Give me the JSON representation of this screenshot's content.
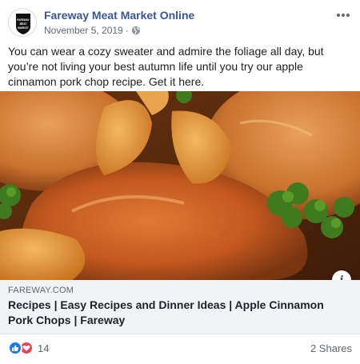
{
  "post": {
    "page_name": "Fareway Meat Market Online",
    "avatar_text": [
      "FAREWAY",
      "MEAT",
      "MARKET"
    ],
    "date": "November 5, 2019",
    "separator": "·",
    "privacy_icon": "globe-icon",
    "more_icon": "ellipsis-icon",
    "text": "You can wear a cozy sweater and admire the foliage all day, but you’re not living your best autumn life until you try our apple cinnamon pork chop recipe. Get it here."
  },
  "link": {
    "domain": "FAREWAY.COM",
    "title": "Recipes | Easy Recipes and Dinner Ideas | Apple Cinnamon Pork Chops | Fareway",
    "info_icon": "info-icon",
    "image_description_icon": "pork-chop-photo"
  },
  "footer": {
    "reaction_icons": [
      "like-icon",
      "love-icon"
    ],
    "reaction_count": "14",
    "shares": "2 Shares"
  },
  "colors": {
    "page_name": "#385898",
    "like": "#1877f2",
    "love": "#f33e58",
    "link_bg": "#f2f3f5"
  }
}
